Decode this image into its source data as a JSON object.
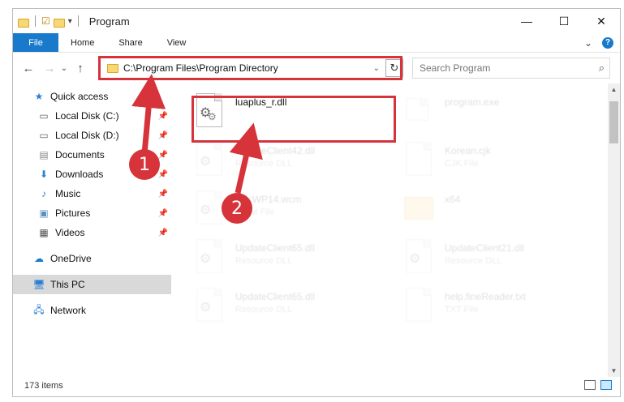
{
  "window": {
    "title": "Program",
    "minimize": "—",
    "maximize": "☐",
    "close": "✕"
  },
  "ribbon": {
    "file": "File",
    "tabs": [
      "Home",
      "Share",
      "View"
    ],
    "expand": "⌄",
    "help": "?"
  },
  "nav": {
    "back": "←",
    "forward": "→",
    "recent": "⌄",
    "up": "↑",
    "address": "C:\\Program Files\\Program Directory",
    "refresh": "↻",
    "search_placeholder": "Search Program",
    "search_icon": "magnifier-icon"
  },
  "sidebar": {
    "items": [
      {
        "label": "Quick access",
        "icon": "star-icon",
        "pinned": false
      },
      {
        "label": "Local Disk (C:)",
        "icon": "drive-icon",
        "pinned": true
      },
      {
        "label": "Local Disk (D:)",
        "icon": "drive-icon",
        "pinned": true
      },
      {
        "label": "Documents",
        "icon": "documents-icon",
        "pinned": true
      },
      {
        "label": "Downloads",
        "icon": "download-icon",
        "pinned": true
      },
      {
        "label": "Music",
        "icon": "music-icon",
        "pinned": true
      },
      {
        "label": "Pictures",
        "icon": "pictures-icon",
        "pinned": true
      },
      {
        "label": "Videos",
        "icon": "videos-icon",
        "pinned": true
      },
      {
        "label": "OneDrive",
        "icon": "cloud-icon",
        "pinned": false
      },
      {
        "label": "This PC",
        "icon": "computer-icon",
        "pinned": false
      },
      {
        "label": "Network",
        "icon": "network-icon",
        "pinned": false
      }
    ]
  },
  "files": [
    {
      "name": "luaplus_r.dll",
      "type": "",
      "icon": "dll-icon",
      "faded": false
    },
    {
      "name": "program.exe",
      "type": "",
      "icon": "exe-icon",
      "faded": true
    },
    {
      "name": "UpdateClient42.dll",
      "type": "Resource DLL",
      "icon": "dll-icon",
      "faded": true
    },
    {
      "name": "Korean.cjk",
      "type": "CJK File",
      "icon": "file-icon",
      "faded": true
    },
    {
      "name": "WfsWP14.wcm",
      "type": "WCM File",
      "icon": "dll-icon",
      "faded": true
    },
    {
      "name": "x64",
      "type": "",
      "icon": "folder-icon",
      "faded": true
    },
    {
      "name": "UpdateClient65.dll",
      "type": "Resource DLL",
      "icon": "dll-icon",
      "faded": true
    },
    {
      "name": "UpdateClient21.dll",
      "type": "Resource DLL",
      "icon": "dll-icon",
      "faded": true
    },
    {
      "name": "UpdateClient65.dll",
      "type": "Resource DLL",
      "icon": "dll-icon",
      "faded": true
    },
    {
      "name": "help.fineReader.txt",
      "type": "TXT File",
      "icon": "file-icon",
      "faded": true
    }
  ],
  "status": {
    "count": "173 items"
  },
  "annotations": {
    "step1": "1",
    "step2": "2",
    "color": "#d6333a"
  },
  "colors": {
    "accent": "#1979ca",
    "selection": "#cce8ff",
    "highlight": "#d6333a"
  }
}
